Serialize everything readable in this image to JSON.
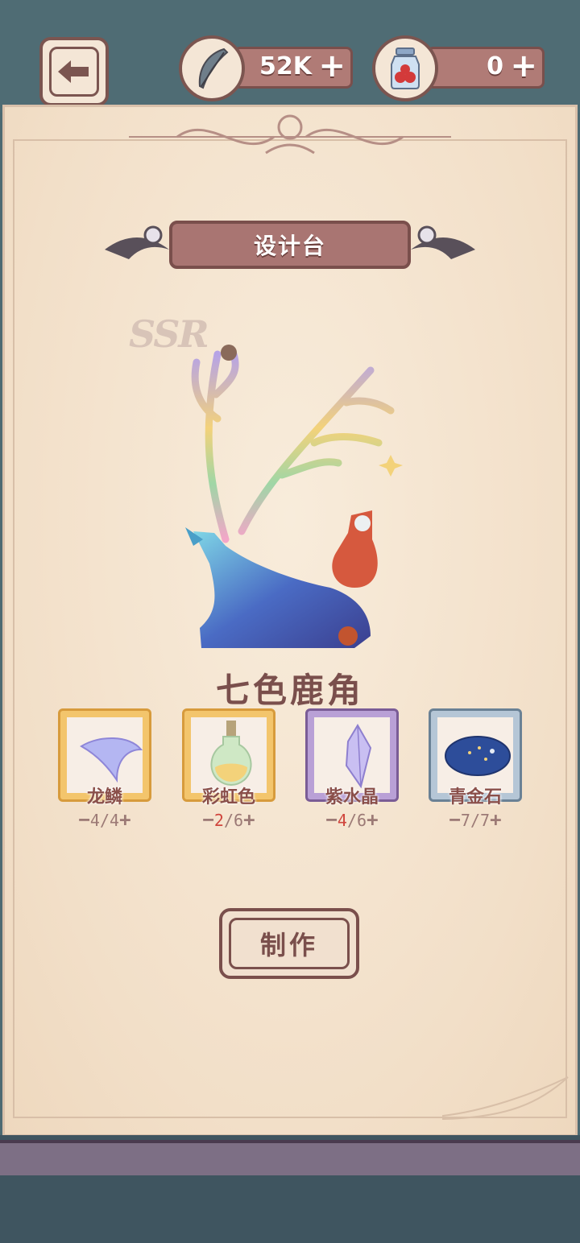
{
  "topbar": {
    "feather_amount": "52K",
    "jar_amount": "0",
    "plus": "+"
  },
  "panel": {
    "title": "设计台",
    "rarity": "SSR",
    "item_name": "七色鹿角",
    "make_label": "制作"
  },
  "materials": [
    {
      "name": "龙鳞",
      "have": "4",
      "need": "4",
      "frame": "gold",
      "icon": "scale-icon"
    },
    {
      "name": "彩虹色",
      "have": "2",
      "need": "6",
      "frame": "gold",
      "icon": "potion-icon"
    },
    {
      "name": "紫水晶",
      "have": "4",
      "need": "6",
      "frame": "purple",
      "icon": "crystal-icon"
    },
    {
      "name": "青金石",
      "have": "7",
      "need": "7",
      "frame": "blue",
      "icon": "lapis-icon"
    }
  ],
  "colors": {
    "primary_brown": "#7a4f4c",
    "parchment": "#f5e6d2",
    "low_count": "#d0453d"
  }
}
